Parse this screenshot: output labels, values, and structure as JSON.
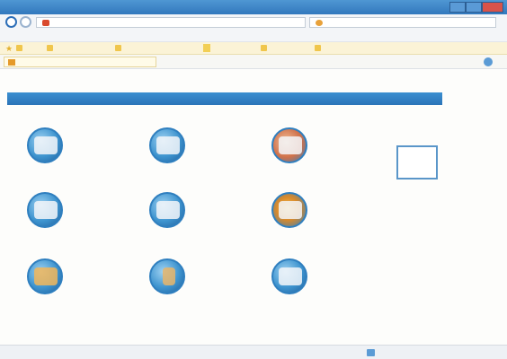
{
  "window": {
    "title": "",
    "url": "",
    "search_placeholder": ""
  },
  "menu": [
    "",
    "",
    "",
    "",
    "",
    ""
  ],
  "favorites": {
    "items": [
      "",
      "",
      "",
      "",
      "",
      ""
    ]
  },
  "tab": {
    "label": ""
  },
  "command_bar": {
    "items": [
      "",
      "",
      "",
      "",
      "",
      ""
    ]
  },
  "page": {
    "heading": "",
    "section_header": "",
    "section_right": "",
    "tiles": [
      {
        "label": "",
        "icon": "category-icon"
      },
      {
        "label": "",
        "icon": "category-icon"
      },
      {
        "label": "",
        "icon": "category-icon"
      },
      {
        "label": "",
        "icon": "category-icon"
      },
      {
        "label": "",
        "icon": "category-icon"
      },
      {
        "label": "",
        "icon": "category-icon"
      },
      {
        "label": "",
        "icon": "category-icon"
      },
      {
        "label": "",
        "icon": "category-icon"
      },
      {
        "label": "",
        "icon": "category-icon"
      }
    ],
    "info_box_text": ""
  },
  "status": {
    "url": "",
    "zone": "",
    "zoom": ""
  },
  "colors": {
    "title_bar": "#3f86c8",
    "heading": "#e46a2b",
    "section_bar": "#2f7fbf",
    "favorites_bar": "#fbf3d6"
  }
}
